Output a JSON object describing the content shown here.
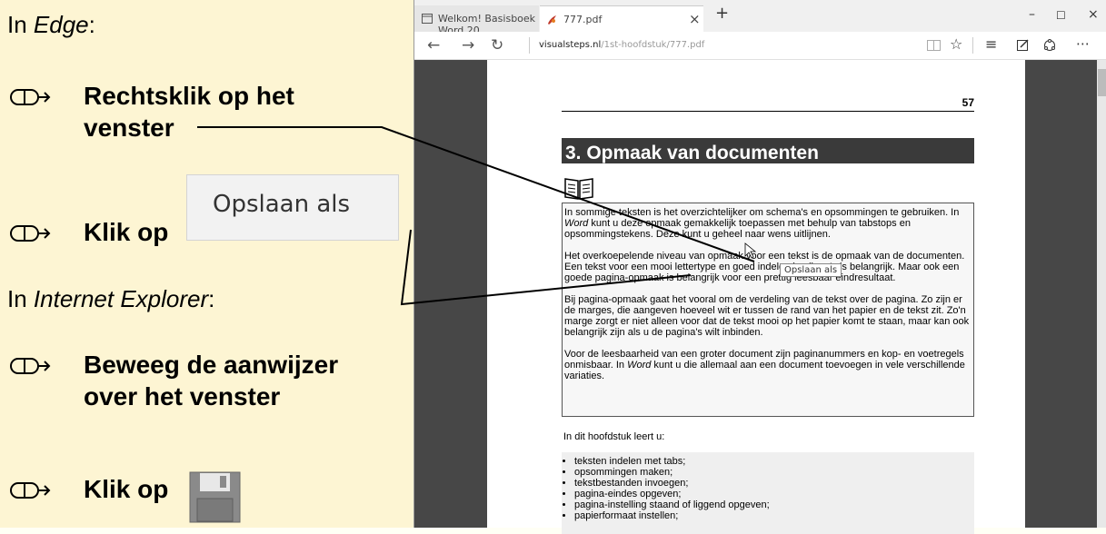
{
  "left_panel": {
    "heading_edge_prefix": "In ",
    "heading_edge_app": "Edge",
    "heading_edge_suffix": ":",
    "step1_line1": "Rechtsklik op het",
    "step1_line2": "venster",
    "step2_label": "Klik op",
    "button_callout": "Opslaan als",
    "heading_ie_prefix": "In ",
    "heading_ie_app": "Internet Explorer",
    "heading_ie_suffix": ":",
    "step3_line1": "Beweeg de aanwijzer",
    "step3_line2": "over het venster",
    "step4_label": "Klik op"
  },
  "browser": {
    "tabs": [
      {
        "label": "Welkom! Basisboek Word 20"
      },
      {
        "label": "777.pdf"
      }
    ],
    "new_tab": "+",
    "tab_close": "×",
    "window_controls": {
      "minimize": "–",
      "maximize": "☐",
      "close": "×"
    },
    "url_host": "visualsteps.nl",
    "url_path": "/1st-hoofdstuk/777.pdf"
  },
  "pdf": {
    "page_number": "57",
    "chapter_title": "3. Opmaak van documenten",
    "intro_p1_a": "In sommige teksten is het overzichtelijker om schema's en opsommingen te gebruiken. In ",
    "intro_p1_word": "Word",
    "intro_p1_b": " kunt u deze opmaak gemakkelijk toepassen met behulp van tabstops en opsommingstekens. Deze kunt u geheel naar wens uitlijnen.",
    "intro_p2": "Het overkoepelende niveau van opmaak voor een tekst is de opmaak van de documenten. Een tekst voor een mooi lettertype en goed indelen in alinea's is belangrijk. Maar ook een goede pagina-opmaak is belangrijk voor een prettig leesbaar eindresultaat.",
    "intro_p3": "Bij pagina-opmaak gaat het vooral om de verdeling van de tekst over de pagina. Zo zijn er de marges, die aangeven hoeveel wit er tussen de rand van het papier en de tekst zit. Zo'n marge zorgt er niet alleen voor dat de tekst mooi op het papier komt te staan, maar kan ook belangrijk zijn als u de pagina's wilt inbinden.",
    "intro_p4_a": "Voor de leesbaarheid van een groter document zijn paginanummers en kop- en voetregels onmisbaar. In ",
    "intro_p4_word": "Word",
    "intro_p4_b": " kunt u die allemaal aan een document toevoegen in vele verschillende variaties.",
    "learn_heading": "In dit hoofdstuk leert u:",
    "learn_items": [
      "teksten indelen met tabs;",
      "opsommingen maken;",
      "tekstbestanden invoegen;",
      "pagina-eindes opgeven;",
      "pagina-instelling staand of liggend opgeven;",
      "papierformaat instellen;"
    ],
    "tooltip": "Opslaan als"
  }
}
